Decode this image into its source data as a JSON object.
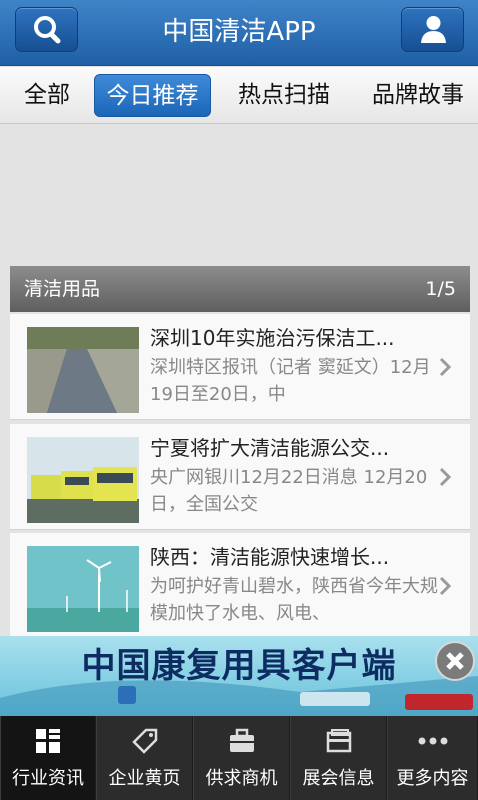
{
  "header": {
    "title": "中国清洁APP",
    "left_icon": "search-icon",
    "right_icon": "user-icon"
  },
  "tabs": [
    {
      "label": "全部",
      "active": false
    },
    {
      "label": "今日推荐",
      "active": true
    },
    {
      "label": "热点扫描",
      "active": false
    },
    {
      "label": "品牌故事",
      "active": false
    }
  ],
  "section": {
    "title": "清洁用品",
    "page": "1/5"
  },
  "news": [
    {
      "title": "深圳10年实施治污保洁工...",
      "summary": "深圳特区报讯（记者 窦延文）12月19日至20日，中"
    },
    {
      "title": "宁夏将扩大清洁能源公交...",
      "summary": "央广网银川12月22日消息 12月20日，全国公交"
    },
    {
      "title": "陕西：清洁能源快速增长...",
      "summary": "为呵护好青山碧水，陕西省今年大规模加快了水电、风电、"
    }
  ],
  "ad": {
    "text": "中国康复用具客户端",
    "close_icon": "close-icon"
  },
  "nav": [
    {
      "label": "行业资讯",
      "icon": "grid-icon",
      "active": true
    },
    {
      "label": "企业黄页",
      "icon": "tag-icon",
      "active": false
    },
    {
      "label": "供求商机",
      "icon": "briefcase-icon",
      "active": false
    },
    {
      "label": "展会信息",
      "icon": "folder-icon",
      "active": false
    },
    {
      "label": "更多内容",
      "icon": "more-icon",
      "active": false
    }
  ],
  "colors": {
    "header": "#1f5fa6",
    "tab_active": "#2a72c4",
    "nav_bg": "#2c2c2c"
  }
}
